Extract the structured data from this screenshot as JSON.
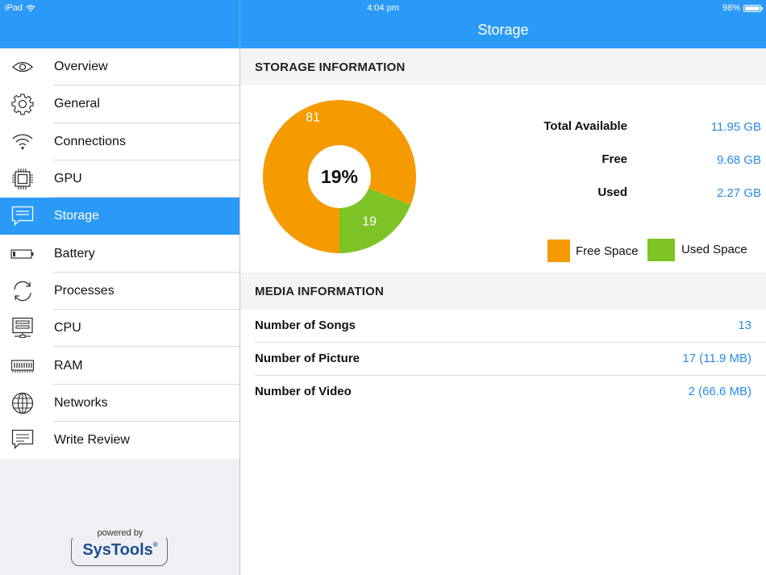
{
  "status_bar": {
    "device": "iPad",
    "time": "4:04 pm",
    "battery": "98%",
    "battery_level": 0.98
  },
  "header": {
    "title": "Storage"
  },
  "sidebar": {
    "items": [
      {
        "label": "Overview",
        "icon": "eye-icon",
        "active": false
      },
      {
        "label": "General",
        "icon": "gear-icon",
        "active": false
      },
      {
        "label": "Connections",
        "icon": "wifi-icon",
        "active": false
      },
      {
        "label": "GPU",
        "icon": "chip-icon",
        "active": false
      },
      {
        "label": "Storage",
        "icon": "chat-bubble-icon",
        "active": true
      },
      {
        "label": "Battery",
        "icon": "battery-icon",
        "active": false
      },
      {
        "label": "Processes",
        "icon": "refresh-icon",
        "active": false
      },
      {
        "label": "CPU",
        "icon": "cpu-icon",
        "active": false
      },
      {
        "label": "RAM",
        "icon": "ram-icon",
        "active": false
      },
      {
        "label": "Networks",
        "icon": "globe-icon",
        "active": false
      },
      {
        "label": "Write Review",
        "icon": "comment-icon",
        "active": false
      }
    ],
    "logo": {
      "powered_by": "powered by",
      "name": "SysTools",
      "reg": "®"
    }
  },
  "storage": {
    "section_title": "STORAGE INFORMATION",
    "total_label": "Total Available",
    "total_value": "11.95 GB",
    "free_label": "Free",
    "free_value": "9.68 GB",
    "used_label": "Used",
    "used_value": "2.27 GB",
    "legend_free": "Free Space",
    "legend_used": "Used Space"
  },
  "media": {
    "section_title": "MEDIA INFORMATION",
    "rows": [
      {
        "label": "Number of Songs",
        "value": "13"
      },
      {
        "label": "Number of Picture",
        "value": "17 (11.9 MB)"
      },
      {
        "label": "Number of Video",
        "value": "2 (66.6 MB)"
      }
    ]
  },
  "colors": {
    "accent": "#2a9af6",
    "free": "#f59b00",
    "used": "#7ec326",
    "value_blue": "#2a8ae6"
  },
  "chart_data": {
    "type": "pie",
    "center_label": "19%",
    "slices": [
      {
        "name": "Free Space",
        "value": 81,
        "label": "81",
        "color": "#f59b00"
      },
      {
        "name": "Used Space",
        "value": 19,
        "label": "19",
        "color": "#7ec326"
      }
    ],
    "legend_position": "bottom-right"
  }
}
